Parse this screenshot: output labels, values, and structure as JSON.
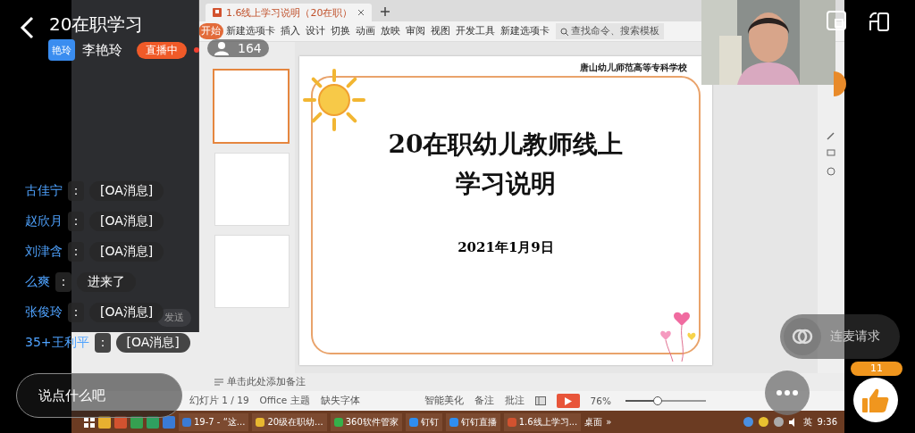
{
  "title": "20在职学习",
  "host": {
    "avatar_text": "艳玲",
    "name": "李艳玲",
    "status": "直播中"
  },
  "viewers": "164",
  "comments": [
    {
      "user": "古佳宁",
      "separator": "：",
      "text": "[OA消息]"
    },
    {
      "user": "赵欣月",
      "separator": "：",
      "text": "[OA消息]"
    },
    {
      "user": "刘津含",
      "separator": "：",
      "text": "[OA消息]"
    },
    {
      "user": "么爽",
      "separator": "：",
      "text": "进来了"
    },
    {
      "user": "张俊玲",
      "separator": "：",
      "text": "[OA消息]"
    },
    {
      "user": "35+王利平",
      "separator": "：",
      "text": "[OA消息]"
    }
  ],
  "comment_input": {
    "placeholder": "说点什么吧"
  },
  "mic_request": "连麦请求",
  "likes": "11",
  "live_panel": {
    "send_button": "发送"
  },
  "wps": {
    "tab_title": "1.6线上学习说明（20在职）",
    "ribbon_tabs": [
      {
        "label": "开始",
        "selected": true
      },
      {
        "label": "新建选项卡",
        "selected": false
      },
      {
        "label": "插入",
        "selected": false
      },
      {
        "label": "设计",
        "selected": false
      },
      {
        "label": "切换",
        "selected": false
      },
      {
        "label": "动画",
        "selected": false
      },
      {
        "label": "放映",
        "selected": false
      },
      {
        "label": "审阅",
        "selected": false
      },
      {
        "label": "视图",
        "selected": false
      },
      {
        "label": "开发工具",
        "selected": false
      },
      {
        "label": "新建选项卡",
        "selected": false
      }
    ],
    "search_placeholder": "查找命令、搜索模板",
    "slide": {
      "school": "唐山幼儿师范高等专科学校",
      "title_lines": [
        "20在职幼儿教师线上",
        "学习说明"
      ],
      "date": "2021年1月9日"
    },
    "notes_placeholder": "单击此处添加备注",
    "status": {
      "slide_count": "幻灯片 1 / 19",
      "theme": "Office 主题",
      "missing_font": "缺失字体",
      "beautify": "智能美化",
      "notes": "备注",
      "comment": "批注",
      "zoom": "76%",
      "zoom_slider": {
        "level": 0.4
      }
    }
  },
  "taskbar": {
    "windows": [
      {
        "label": "19-7 - “这...",
        "color": "#3a7bd5"
      },
      {
        "label": "20级在职幼...",
        "color": "#e8b830"
      },
      {
        "label": "360软件管家",
        "color": "#35b04a"
      },
      {
        "label": "钉钉",
        "color": "#2f8ef0"
      },
      {
        "label": "钉钉直播",
        "color": "#2f8ef0"
      },
      {
        "label": "1.6线上学习...",
        "color": "#d2522f"
      }
    ],
    "desktop": "桌面",
    "more": "»",
    "ime": "英",
    "clock": "9:36"
  }
}
